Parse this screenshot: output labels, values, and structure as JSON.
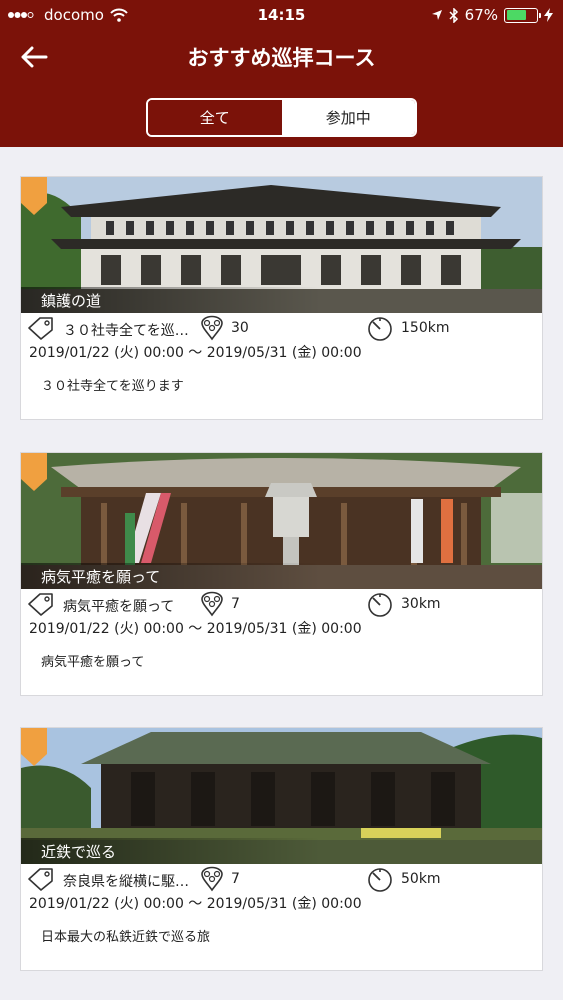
{
  "status": {
    "carrier": "docomo",
    "time": "14:15",
    "battery": "67%",
    "battery_level": 0.67
  },
  "nav": {
    "title": "おすすめ巡拝コース",
    "back_icon": "arrow-left-icon"
  },
  "segment": {
    "all_label": "全て",
    "participating_label": "参加中",
    "selected": "participating"
  },
  "colors": {
    "header": "#7b1209",
    "ribbon": "#f0a040"
  },
  "courses": [
    {
      "name": "鎮護の道",
      "tag": "３０社寺全てを巡…",
      "spots": "30",
      "distance": "150km",
      "period": "2019/01/22 (火) 00:00 〜 2019/05/31 (金) 00:00",
      "description": "３０社寺全てを巡ります"
    },
    {
      "name": "病気平癒を願って",
      "tag": "病気平癒を願って",
      "spots": "7",
      "distance": "30km",
      "period": "2019/01/22 (火) 00:00 〜 2019/05/31 (金) 00:00",
      "description": "病気平癒を願って"
    },
    {
      "name": "近鉄で巡る",
      "tag": "奈良県を縦横に駆…",
      "spots": "7",
      "distance": "50km",
      "period": "2019/01/22 (火) 00:00 〜 2019/05/31 (金) 00:00",
      "description": "日本最大の私鉄近鉄で巡る旅"
    }
  ]
}
